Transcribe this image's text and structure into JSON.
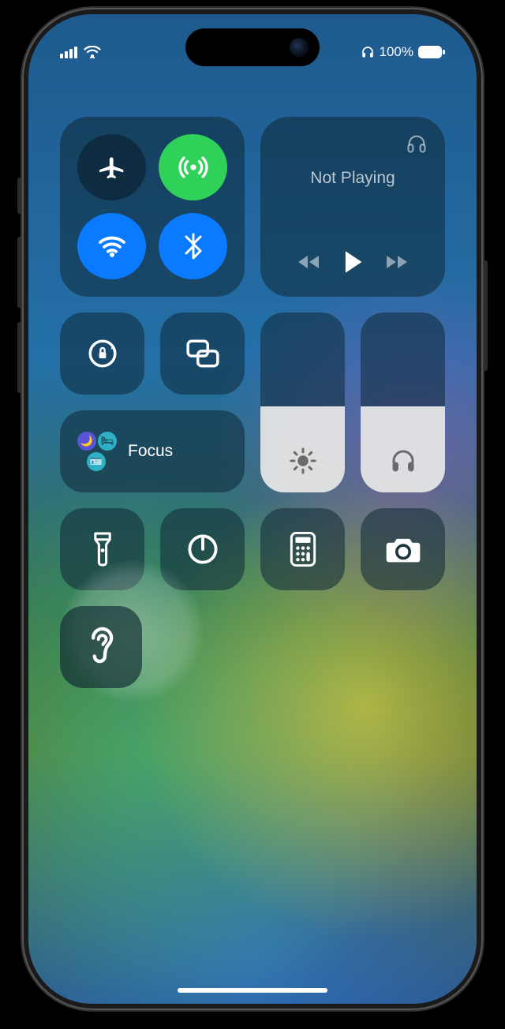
{
  "status": {
    "battery_percent": "100%"
  },
  "media": {
    "title": "Not Playing"
  },
  "focus": {
    "label": "Focus"
  },
  "sliders": {
    "brightness_percent": 48,
    "volume_percent": 48
  },
  "toggles": {
    "airplane": false,
    "cellular": true,
    "wifi": true,
    "bluetooth": true
  },
  "icons": {
    "airplane": "airplane-icon",
    "cellular": "cellular-antenna-icon",
    "wifi": "wifi-icon",
    "bluetooth": "bluetooth-icon",
    "headphones": "headphones-icon",
    "orientation_lock": "orientation-lock-icon",
    "screen_mirroring": "screen-mirroring-icon",
    "brightness": "brightness-icon",
    "volume": "headphones-icon",
    "flashlight": "flashlight-icon",
    "timer": "timer-icon",
    "calculator": "calculator-icon",
    "camera": "camera-icon",
    "hearing": "ear-icon"
  }
}
